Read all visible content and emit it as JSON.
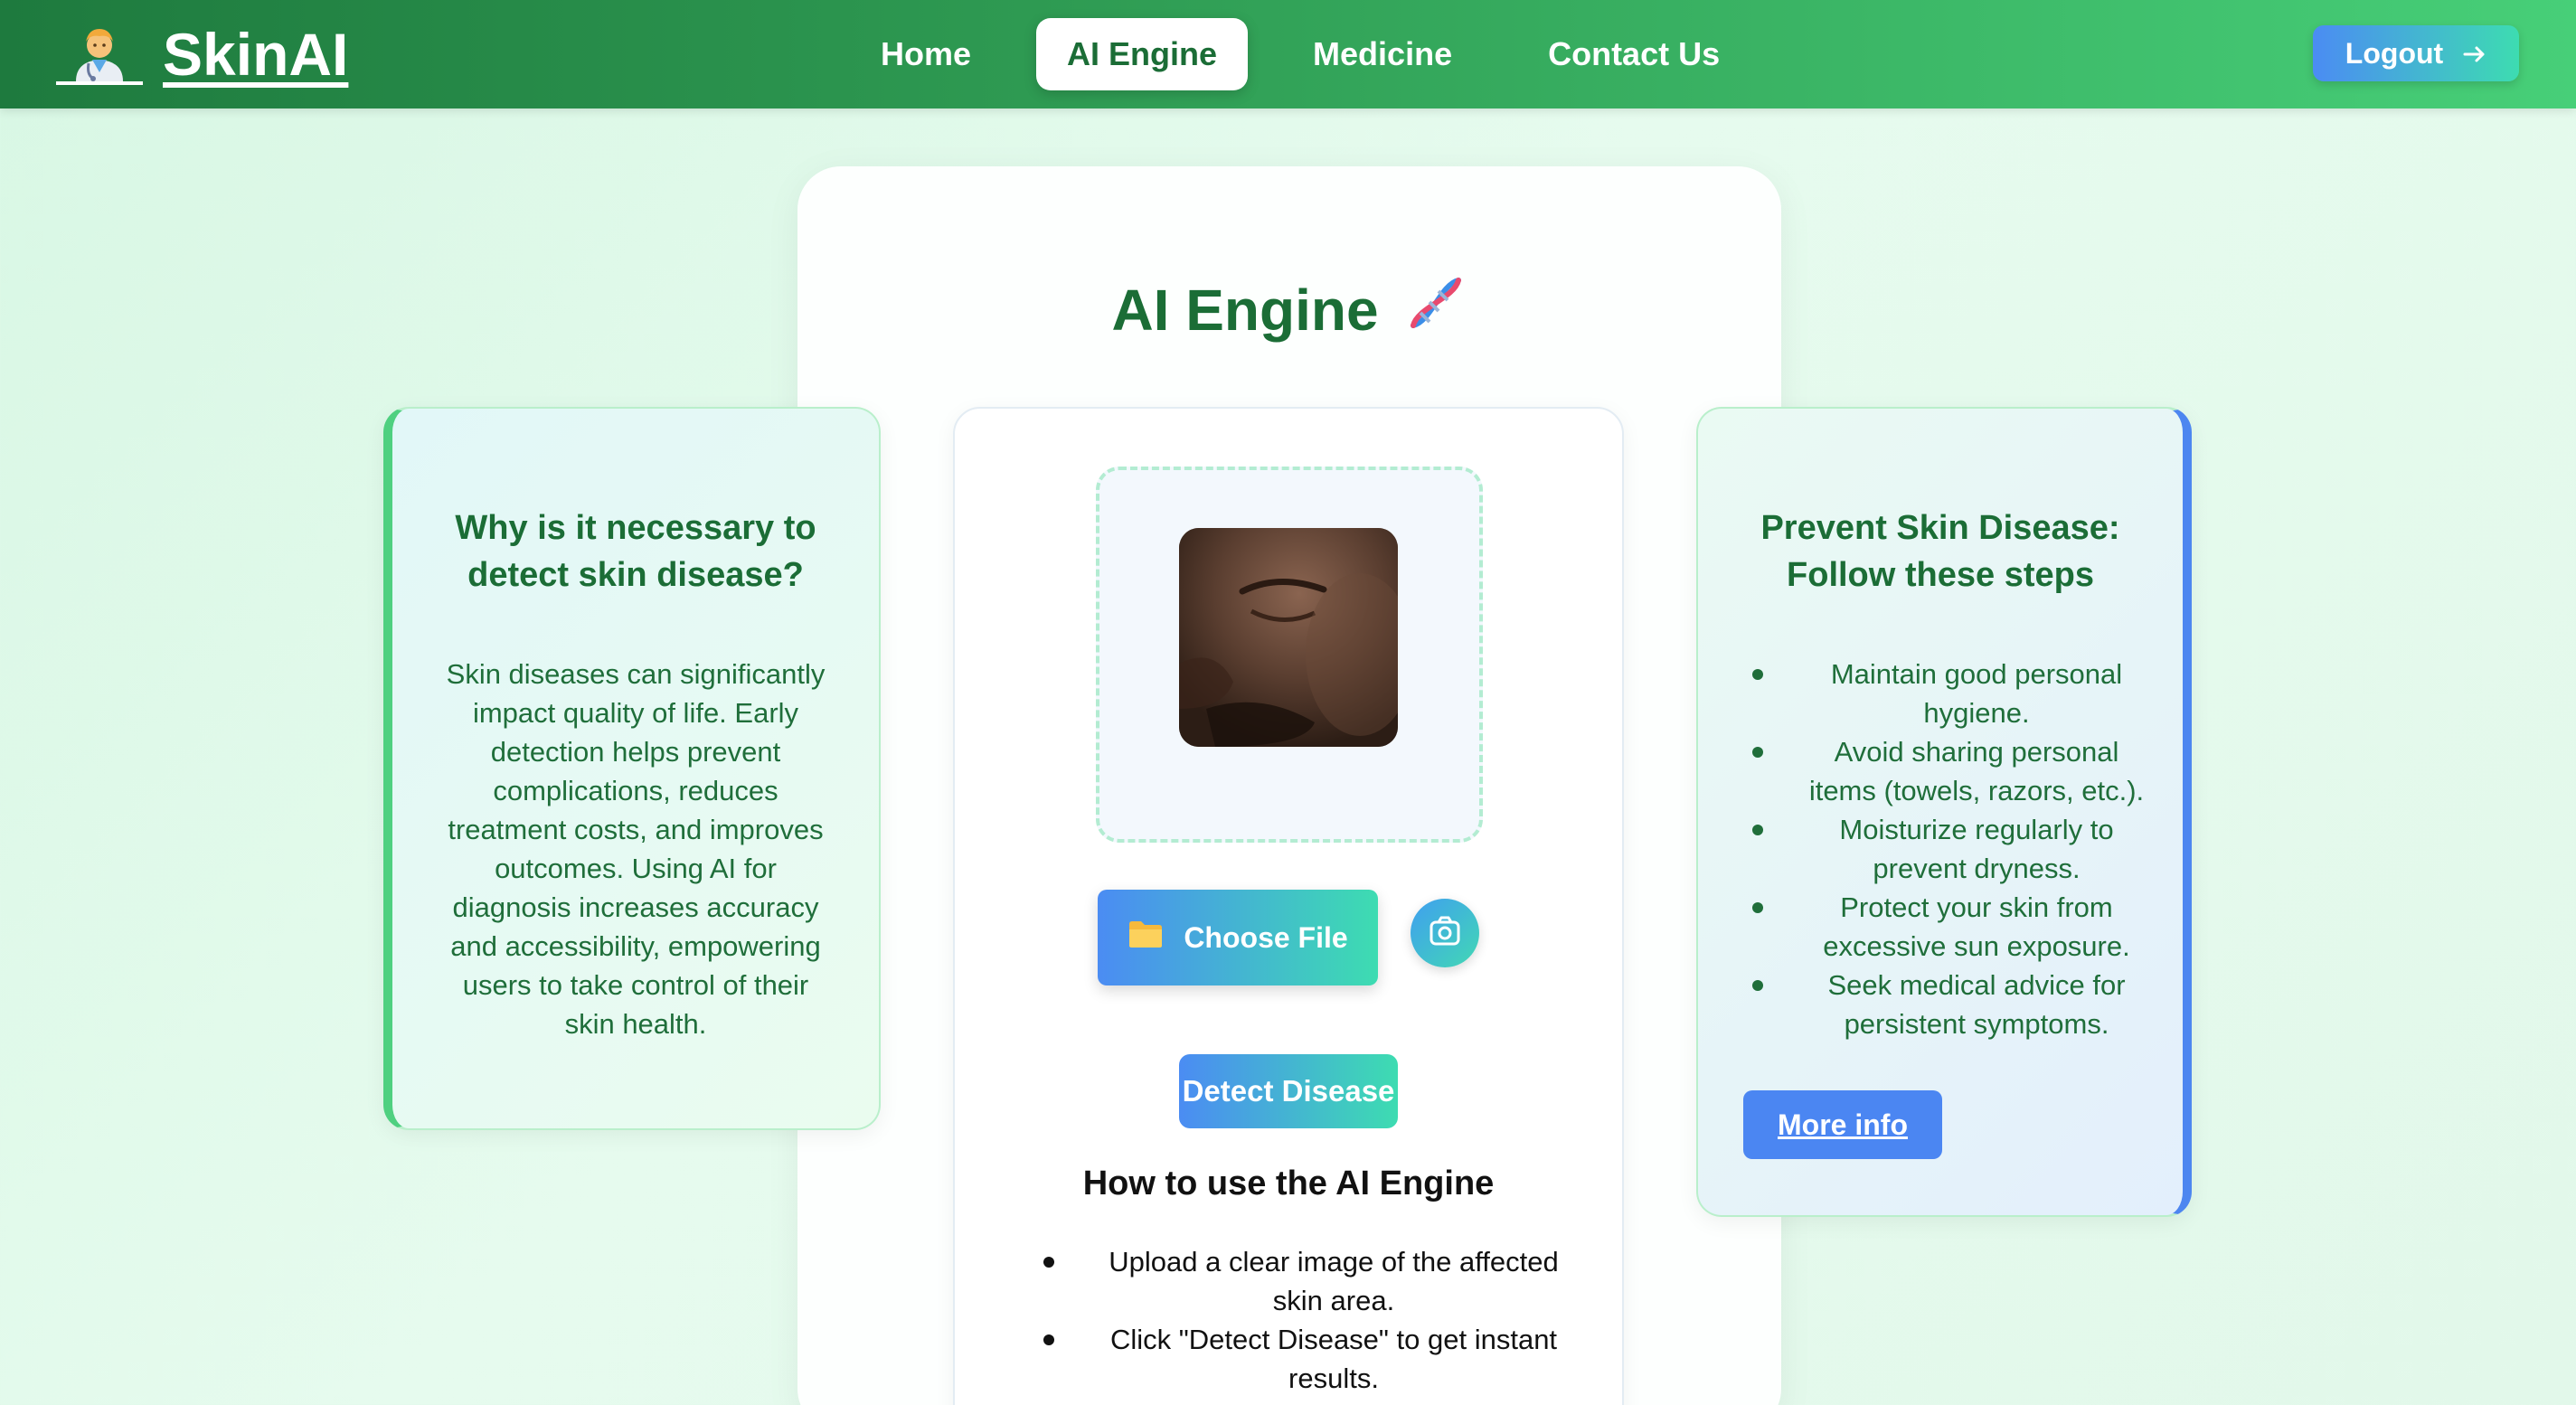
{
  "brand": {
    "name": "SkinAI",
    "icon": "doctor-icon"
  },
  "nav": {
    "links": [
      {
        "label": "Home",
        "active": false
      },
      {
        "label": "AI Engine",
        "active": true
      },
      {
        "label": "Medicine",
        "active": false
      },
      {
        "label": "Contact Us",
        "active": false
      }
    ],
    "logout_label": "Logout",
    "logout_icon": "arrow-right-icon"
  },
  "main": {
    "title": "AI Engine",
    "title_icon": "dna-icon"
  },
  "left_card": {
    "heading": "Why is it necessary to detect skin disease?",
    "body": "Skin diseases can significantly impact quality of life. Early detection helps prevent complications, reduces treatment costs, and improves outcomes. Using AI for diagnosis increases accuracy and accessibility, empowering users to take control of their skin health."
  },
  "right_card": {
    "heading": "Prevent Skin Disease: Follow these steps",
    "tips": [
      "Maintain good personal hygiene.",
      "Avoid sharing personal items (towels, razors, etc.).",
      "Moisturize regularly to prevent dryness.",
      "Protect your skin from excessive sun exposure.",
      "Seek medical advice for persistent symptoms."
    ],
    "more_info_label": "More info"
  },
  "upload": {
    "choose_file_label": "Choose File",
    "choose_file_icon": "folder-icon",
    "camera_icon": "camera-icon",
    "detect_label": "Detect Disease"
  },
  "howto": {
    "heading": "How to use the AI Engine",
    "steps": [
      "Upload a clear image of the affected skin area.",
      "Click \"Detect Disease\" to get instant results."
    ]
  },
  "colors": {
    "nav_start": "#1e7a3e",
    "nav_end": "#47cf78",
    "heading_green": "#1b6d36",
    "accent_blue": "#4b86f2",
    "accent_teal": "#3ddcb1"
  }
}
